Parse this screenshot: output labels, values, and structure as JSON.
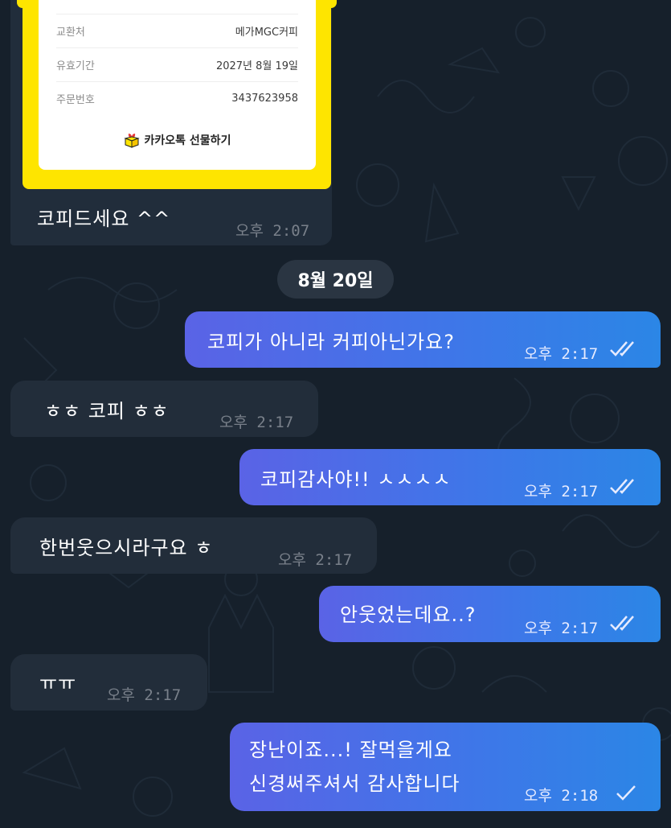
{
  "gift_card": {
    "rows": [
      {
        "label": "교환처",
        "value": "메가MGC커피"
      },
      {
        "label": "유효기간",
        "value": "2027년 8월 19일"
      },
      {
        "label": "주문번호",
        "value": "3437623958"
      }
    ],
    "share_label": "카카오톡 선물하기",
    "share_icon": "gift-box-icon"
  },
  "date_separator": "8월 20일",
  "messages": [
    {
      "direction": "incoming",
      "text": "코피드세요 ^^",
      "time": "오후 2:07"
    },
    {
      "direction": "outgoing",
      "text": "코피가 아니라 커피아닌가요?",
      "time": "오후 2:17",
      "status": "read"
    },
    {
      "direction": "incoming",
      "text": "ㅎㅎ 코피 ㅎㅎ",
      "time": "오후 2:17"
    },
    {
      "direction": "outgoing",
      "text": "코피감사야!! ㅅㅅㅅㅅ",
      "time": "오후 2:17",
      "status": "read"
    },
    {
      "direction": "incoming",
      "text": "한번웃으시라구요 ㅎ",
      "time": "오후 2:17"
    },
    {
      "direction": "outgoing",
      "text": "안웃었는데요..?",
      "time": "오후 2:17",
      "status": "read"
    },
    {
      "direction": "incoming",
      "text": "ㅠㅠ",
      "time": "오후 2:17"
    },
    {
      "direction": "outgoing",
      "text_line1": "장난이죠...! 잘먹을게요",
      "text_line2": "신경써주셔서 감사합니다",
      "time": "오후 2:18",
      "status": "sent"
    }
  ],
  "colors": {
    "background": "#16202b",
    "incoming_bubble": "#222d3a",
    "outgoing_gradient_start": "#5a63e6",
    "outgoing_gradient_end": "#2b86e6",
    "gift_yellow": "#fee500"
  }
}
